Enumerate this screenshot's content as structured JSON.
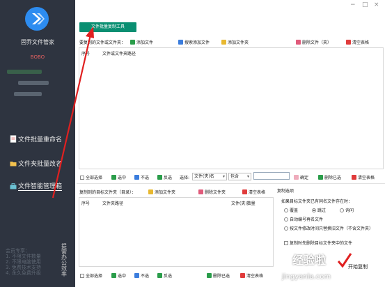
{
  "sidebar": {
    "app_name": "固乔文件管家",
    "user_name": "BOBO",
    "nav": [
      {
        "label": "文件批量重命名",
        "icon": "document-icon"
      },
      {
        "label": "文件夹批量改名",
        "icon": "folder-icon"
      },
      {
        "label": "文件智能管理箱",
        "icon": "toolbox-icon"
      }
    ],
    "promo": [
      "会员专享：",
      "1. 不限文件数量",
      "2. 不限电脑使用",
      "3. 免费技术支持",
      "4. 永久免费升级"
    ],
    "promo_side": "提需办公效率"
  },
  "main": {
    "top_button": "文件批量复制工具",
    "window_controls": [
      "−",
      "□",
      "×"
    ],
    "source_section": {
      "label": "要复制的文件或文件夹：",
      "toolbar": [
        {
          "label": "添加文件",
          "icon": "add-file-icon"
        },
        {
          "label": "搜索添加文件",
          "icon": "search-add-icon"
        },
        {
          "label": "添加文件夹",
          "icon": "add-folder-icon"
        }
      ],
      "right_toolbar": [
        {
          "label": "删除文件（夹）",
          "icon": "delete-icon"
        },
        {
          "label": "清空表格",
          "icon": "clear-table-icon"
        }
      ],
      "columns": [
        "序号",
        "文件或文件夹路径"
      ]
    },
    "source_bottom_bar": {
      "select_all": "全部选择",
      "select": "选中",
      "deselect": "不选",
      "invert": "反选",
      "filter_label": "选择:",
      "filter_field": "文件(夹)名",
      "filter_op": "包含",
      "confirm": "确定",
      "delete_selected": "删除已选",
      "clear_table": "清空表格"
    },
    "target_section": {
      "label": "复制到的目标文件夹（目录）：",
      "add_folder": "添加文件夹",
      "delete_folder": "删除文件夹",
      "clear_table": "清空表格",
      "columns": [
        "序号",
        "文件夹路径",
        "文件(夹)数量"
      ]
    },
    "target_bottom_bar": {
      "select_all": "全部选择",
      "select": "选中",
      "deselect": "不选",
      "invert": "反选",
      "delete_selected": "删除已选",
      "clear_table": "清空表格"
    },
    "copy_options": {
      "title": "复制选项",
      "question": "如果目标文件夹已有同名文件存在时：",
      "radios": [
        {
          "label": "覆盖",
          "checked": false
        },
        {
          "label": "跳过",
          "checked": true
        },
        {
          "label": "询问",
          "checked": false
        }
      ],
      "radio_more": [
        {
          "label": "自动编号再名文件",
          "checked": false
        },
        {
          "label": "按文件修改时间只替换旧文件（不含文件夹）",
          "checked": false
        }
      ],
      "checkbox": "复制时先删除目标文件夹中的文件"
    },
    "start_button": "开始复制",
    "watermark": "经验啦",
    "watermark_url": "jingyanla.com",
    "colors": {
      "sidebar_bg": "#2e3440",
      "accent_green": "#0a8f72",
      "arrow_red": "#e02020"
    }
  }
}
